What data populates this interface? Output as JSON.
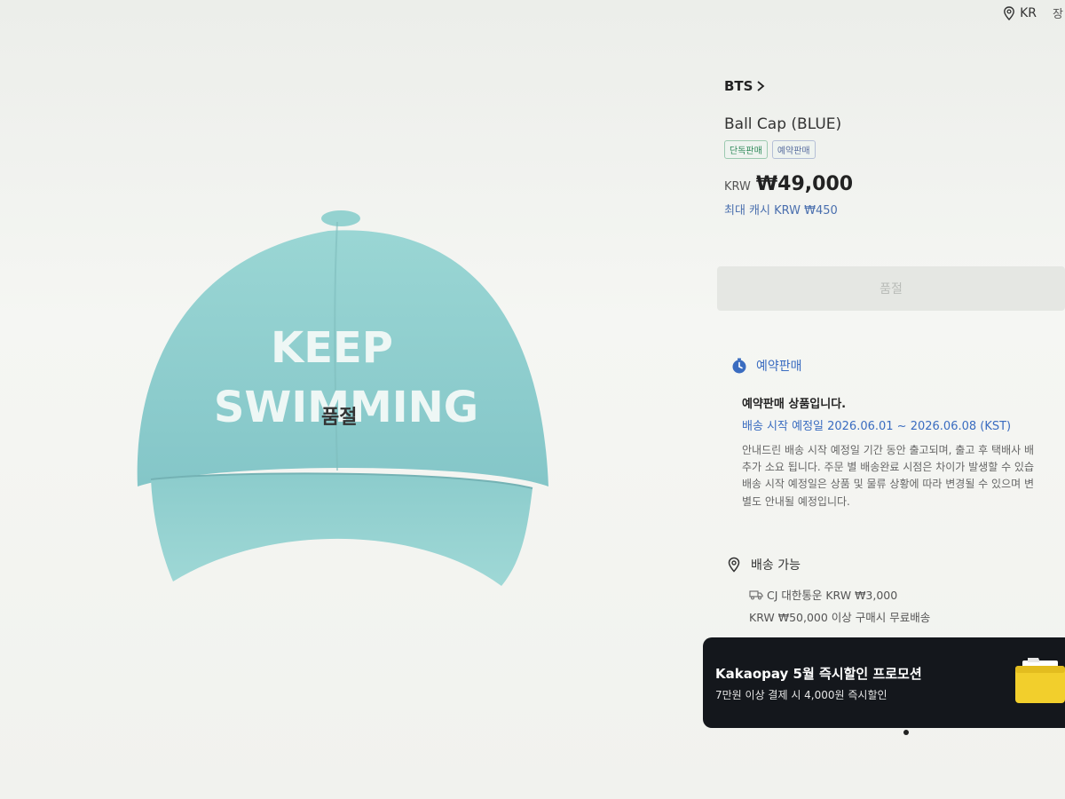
{
  "topbar": {
    "region": "KR",
    "cut_text": "장"
  },
  "product": {
    "brand": "BTS",
    "name": "Ball Cap (BLUE)",
    "badges": [
      "단독판매",
      "예약판매"
    ],
    "currency": "KRW",
    "price": "₩49,000",
    "cash": "최대 캐시 KRW ₩450",
    "sold_out_overlay": "품절",
    "cap_text_line1": "KEEP",
    "cap_text_line2": "SWIMMING"
  },
  "buy_button": {
    "label": "품절"
  },
  "preorder": {
    "title": "예약판매",
    "notice_title": "예약판매 상품입니다.",
    "notice_date": "배송 시작 예정일 2026.06.01 ~ 2026.06.08 (KST)",
    "body_lines": [
      "안내드린 배송 시작 예정일 기간 동안 출고되며, 출고 후 택배사 배",
      "추가 소요 됩니다. 주문 별 배송완료 시점은 차이가 발생할 수 있습",
      "배송 시작 예정일은 상품 및 물류 상황에 따라 변경될 수 있으며 변",
      "별도 안내될 예정입니다."
    ]
  },
  "shipping": {
    "title": "배송 가능",
    "carrier_line": "CJ 대한통운 KRW ₩3,000",
    "free_line": "KRW ₩50,000 이상 구매시 무료배송"
  },
  "promo": {
    "title": "Kakaopay 5월 즉시할인 프로모션",
    "subtitle": "7만원 이상 결제 시 4,000원 즉시할인"
  },
  "colors": {
    "cap": "#8ecfcf",
    "accent_blue": "#3a6cc0",
    "banner_bg": "#14171c",
    "banner_accent": "#f2cf2c"
  }
}
